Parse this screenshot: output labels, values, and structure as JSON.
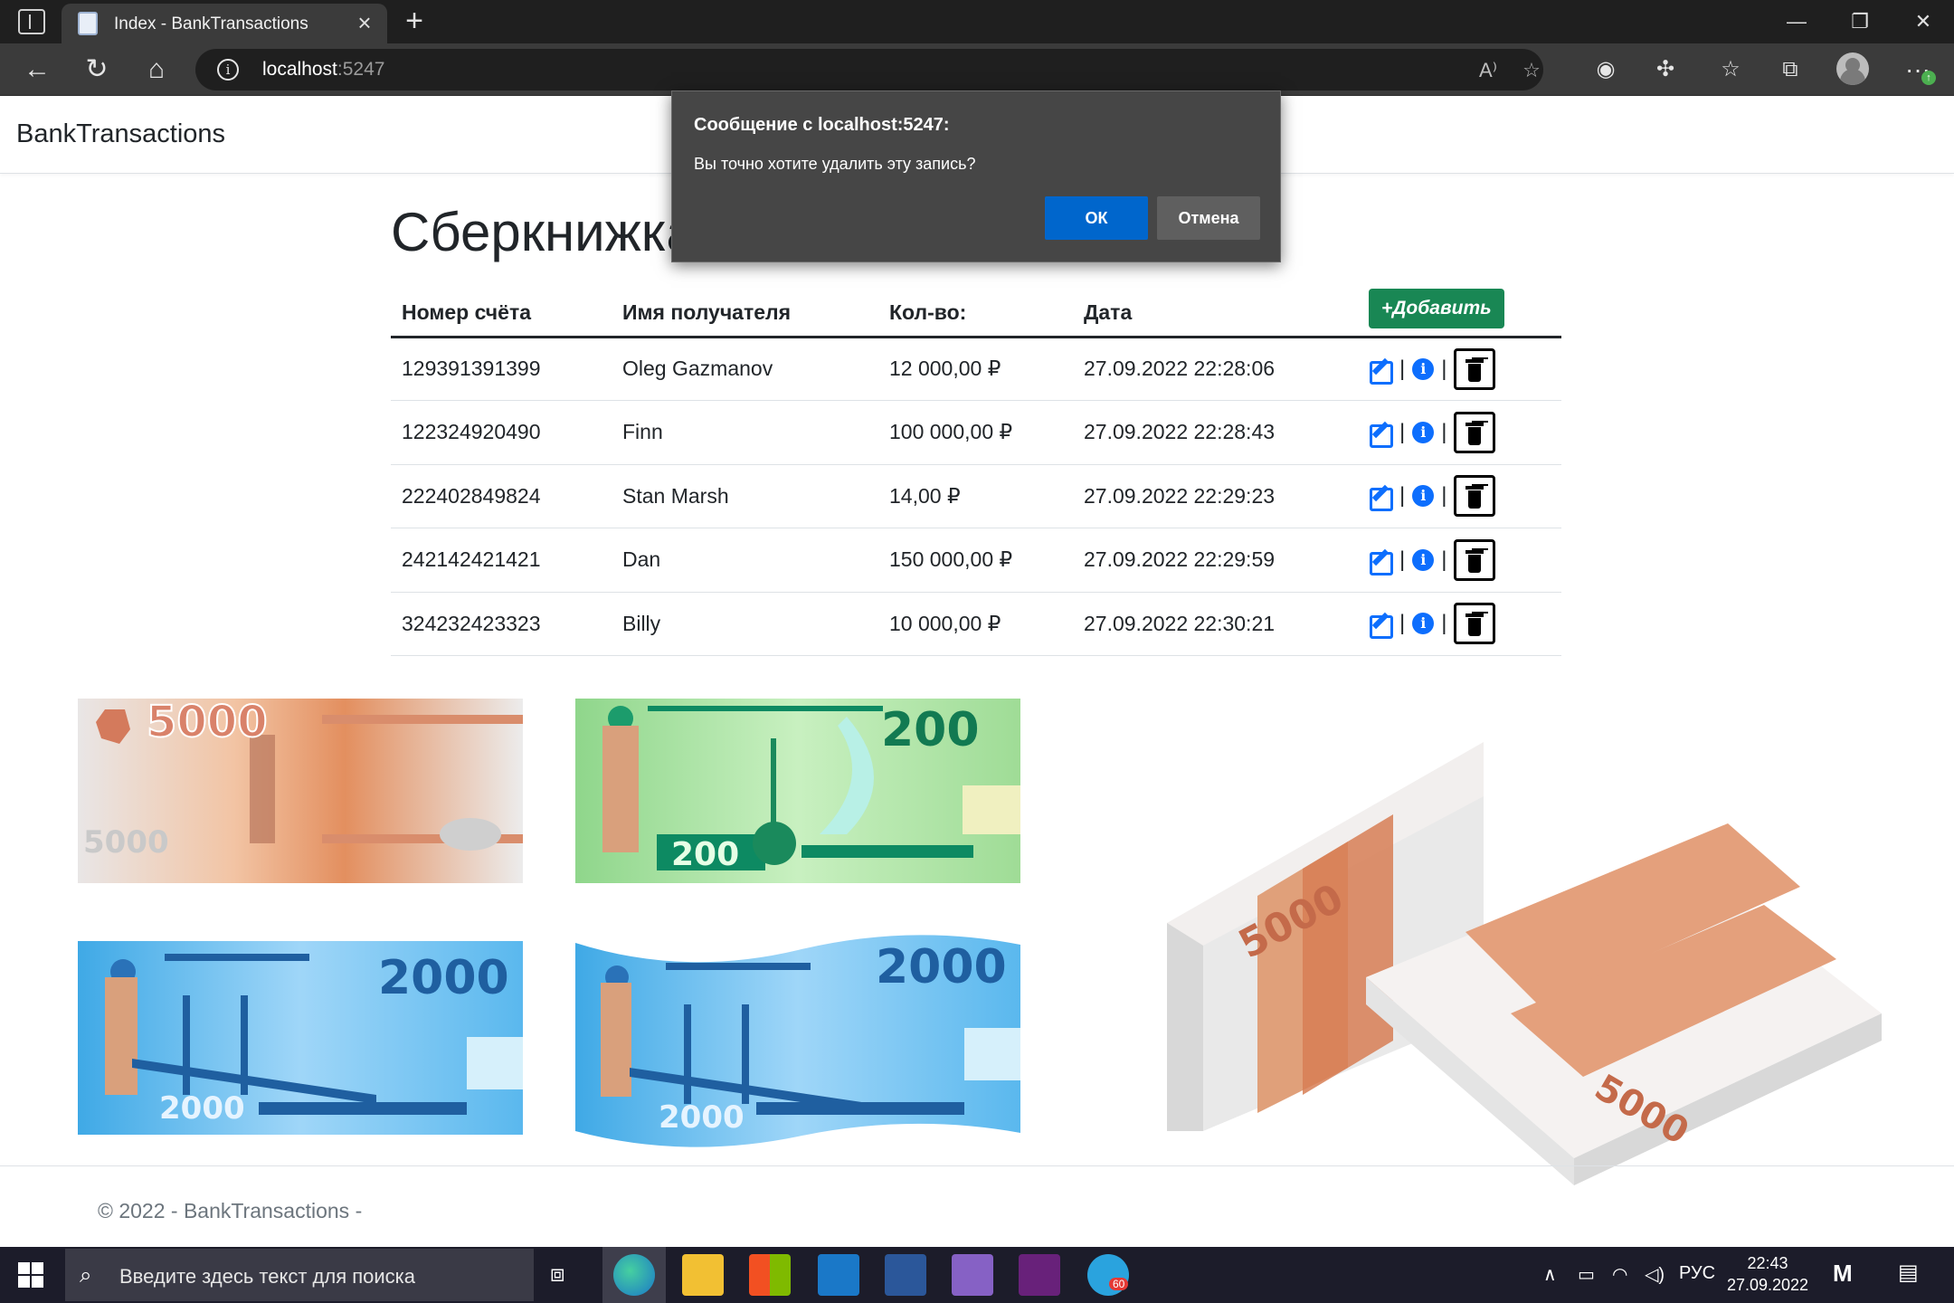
{
  "browser": {
    "tab_title": "Index - BankTransactions",
    "url_host": "localhost",
    "url_port": ":5247"
  },
  "app": {
    "brand": "BankTransactions"
  },
  "page": {
    "title": "Сберкнижка"
  },
  "table": {
    "headers": [
      "Номер счёта",
      "Имя получателя",
      "Кол-во:",
      "Дата"
    ],
    "add_button": "+Добавить",
    "rows": [
      {
        "account": "129391391399",
        "recipient": "Oleg Gazmanov",
        "amount": "12 000,00 ₽",
        "date": "27.09.2022 22:28:06"
      },
      {
        "account": "122324920490",
        "recipient": "Finn",
        "amount": "100 000,00 ₽",
        "date": "27.09.2022 22:28:43"
      },
      {
        "account": "222402849824",
        "recipient": "Stan Marsh",
        "amount": "14,00 ₽",
        "date": "27.09.2022 22:29:23"
      },
      {
        "account": "242142421421",
        "recipient": "Dan",
        "amount": "150 000,00 ₽",
        "date": "27.09.2022 22:29:59"
      },
      {
        "account": "324232423323",
        "recipient": "Billy",
        "amount": "10 000,00 ₽",
        "date": "27.09.2022 22:30:21"
      }
    ]
  },
  "banknotes": {
    "n5000": "5000",
    "n200": "200",
    "n2000": "2000"
  },
  "footer": {
    "text": "© 2022 - BankTransactions -"
  },
  "dialog": {
    "title": "Сообщение с localhost:5247:",
    "message": "Вы точно хотите удалить эту запись?",
    "ok": "ОК",
    "cancel": "Отмена"
  },
  "taskbar": {
    "search_placeholder": "Введите здесь текст для поиска",
    "language": "РУС",
    "time": "22:43",
    "date": "27.09.2022",
    "telegram_badge": "60"
  },
  "colors": {
    "accent_blue": "#0d6efd",
    "add_green": "#198754",
    "dialog_ok": "#0066cc"
  }
}
